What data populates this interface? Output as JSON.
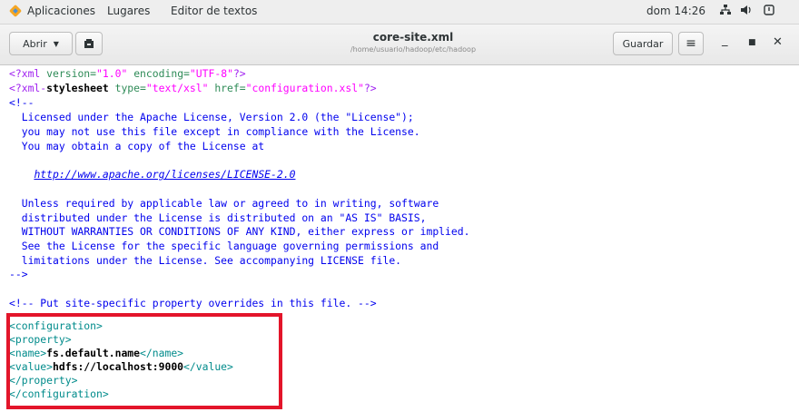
{
  "topbar": {
    "applications": "Aplicaciones",
    "places": "Lugares",
    "app_name": "Editor de textos",
    "clock": "dom 14:26"
  },
  "headerbar": {
    "open_label": "Abrir",
    "title": "core-site.xml",
    "path": "/home/usuario/hadoop/etc/hadoop",
    "save_label": "Guardar"
  },
  "editor": {
    "xml_decl": {
      "open": "<?xml ",
      "a1": "version=",
      "v1": "\"1.0\"",
      "sp": " ",
      "a2": "encoding=",
      "v2": "\"UTF-8\"",
      "close": "?>"
    },
    "stylesheet": {
      "open": "<?xml-",
      "name": "stylesheet",
      "sp1": " ",
      "a1": "type=",
      "v1": "\"text/xsl\"",
      "sp2": " ",
      "a2": "href=",
      "v2": "\"configuration.xsl\"",
      "close": "?>"
    },
    "comment_open": "<!--",
    "license": [
      "  Licensed under the Apache License, Version 2.0 (the \"License\");",
      "  you may not use this file except in compliance with the License.",
      "  You may obtain a copy of the License at"
    ],
    "license_url_indent": "    ",
    "license_url": "http://www.apache.org/licenses/LICENSE-2.0",
    "license2": [
      "  Unless required by applicable law or agreed to in writing, software",
      "  distributed under the License is distributed on an \"AS IS\" BASIS,",
      "  WITHOUT WARRANTIES OR CONDITIONS OF ANY KIND, either express or implied.",
      "  See the License for the specific language governing permissions and",
      "  limitations under the License. See accompanying LICENSE file."
    ],
    "comment_close": "-->",
    "site_comment": "<!-- Put site-specific property overrides in this file. -->",
    "config_open": "<configuration>",
    "property_open": "<property>",
    "name_open": "<name>",
    "name_value": "fs.default.name",
    "name_close": "</name>",
    "value_open": "<value>",
    "value_value": "hdfs://localhost:9000",
    "value_close": "</value>",
    "property_close": "</property>",
    "config_close": "</configuration>"
  }
}
